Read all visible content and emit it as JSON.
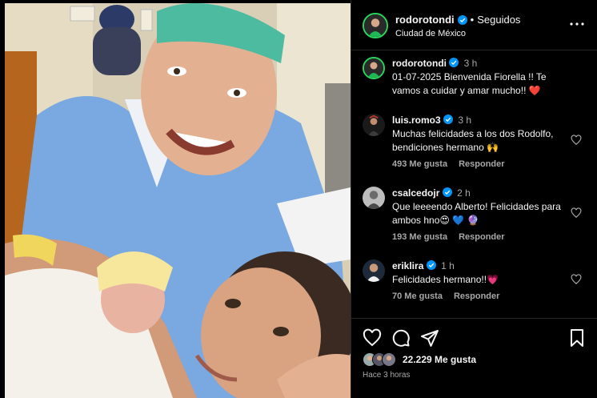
{
  "post": {
    "username": "rodorotondi",
    "follow_state": "Seguidos",
    "separator": "•",
    "location": "Ciudad de México",
    "more_icon": "more-horizontal-icon"
  },
  "caption": {
    "username": "rodorotondi",
    "time": "3 h",
    "text": "01-07-2025 Bienvenida Fiorella !! Te vamos a cuidar y amar mucho!! ❤️"
  },
  "comments": [
    {
      "username": "luis.romo3",
      "verified": true,
      "time": "3 h",
      "text": "Muchas felicidades a los dos Rodolfo, bendiciones hermano 🙌",
      "likes": "493 Me gusta",
      "reply": "Responder"
    },
    {
      "username": "csalcedojr",
      "verified": true,
      "time": "2 h",
      "text": "Que leeeendo Alberto! Felicidades para ambos hno😍 💙 🔮",
      "likes": "193 Me gusta",
      "reply": "Responder"
    },
    {
      "username": "eriklira",
      "verified": true,
      "time": "1 h",
      "text": "Felicidades hermano!!💗",
      "likes": "70 Me gusta",
      "reply": "Responder"
    }
  ],
  "footer": {
    "likes_text": "22.229 Me gusta",
    "time_ago": "Hace 3 horas"
  },
  "colors": {
    "background": "#000000",
    "verified": "#0095f6",
    "heart": "#ff3040",
    "muted_text": "#a8a8a8",
    "story_ring": "#2bd45b"
  }
}
